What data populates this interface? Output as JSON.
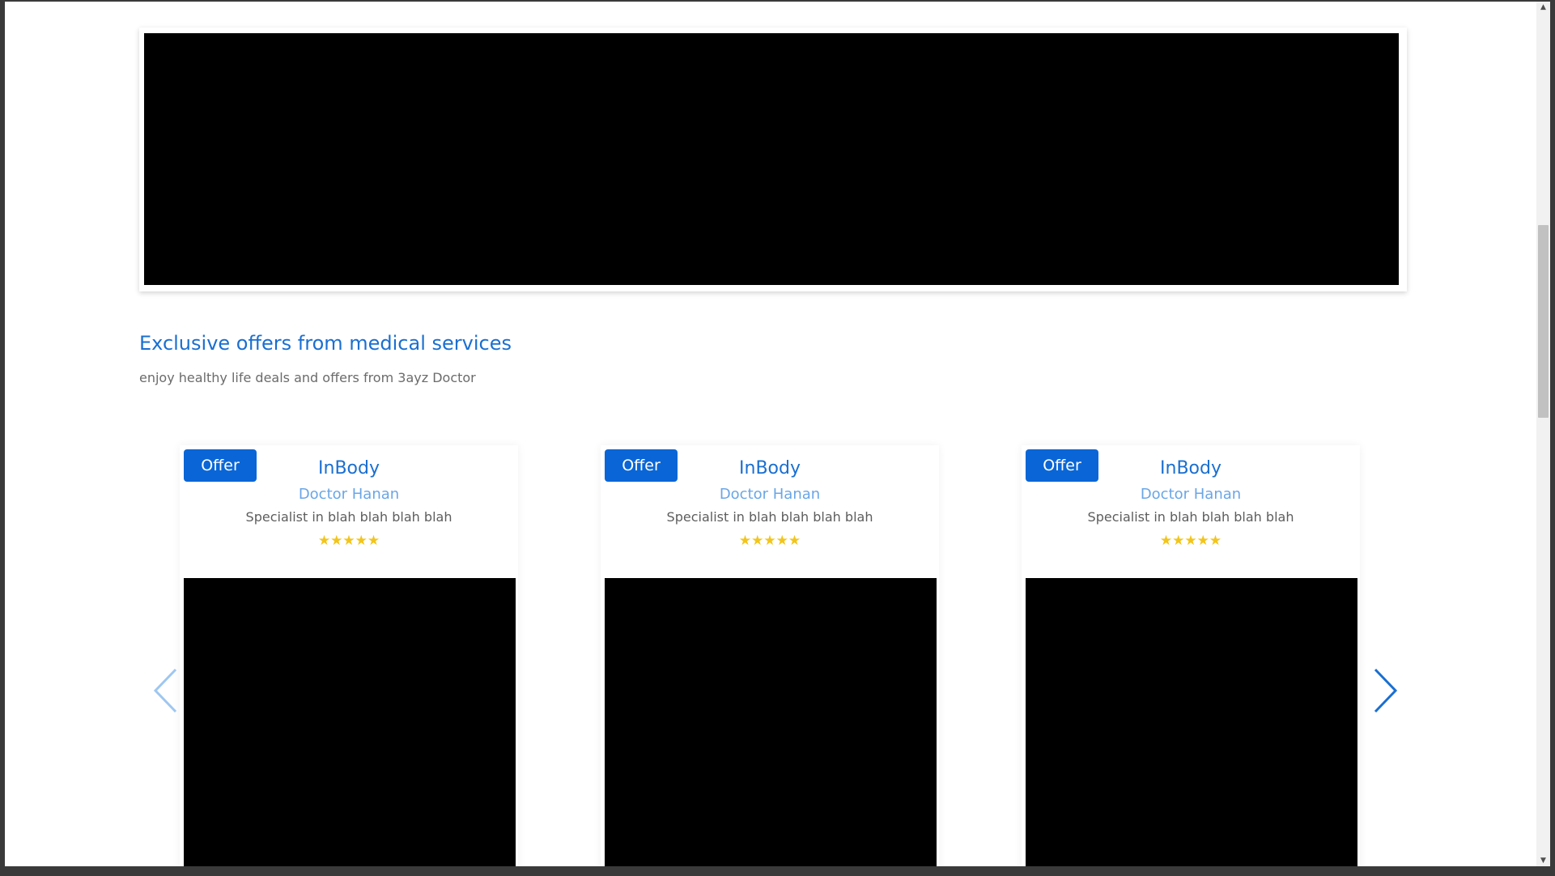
{
  "section": {
    "title": "Exclusive offers from medical services",
    "subtitle": "enjoy healthy life deals and offers from 3ayz Doctor"
  },
  "cards": [
    {
      "badge": "Offer",
      "title": "InBody",
      "doctor": "Doctor Hanan",
      "specialty": "Specialist in blah blah blah blah",
      "rating": 5
    },
    {
      "badge": "Offer",
      "title": "InBody",
      "doctor": "Doctor Hanan",
      "specialty": "Specialist in blah blah blah blah",
      "rating": 5
    },
    {
      "badge": "Offer",
      "title": "InBody",
      "doctor": "Doctor Hanan",
      "specialty": "Specialist in blah blah blah blah",
      "rating": 5
    }
  ],
  "icons": {
    "prev": "chevron-left-icon",
    "next": "chevron-right-icon",
    "star": "star-icon"
  },
  "colors": {
    "accent": "#0a66d6",
    "title": "#1a6fd1",
    "doctor": "#6aa6e6",
    "star": "#f2c51c",
    "prev_arrow": "#9ec7f0",
    "next_arrow": "#1a6fd1"
  }
}
